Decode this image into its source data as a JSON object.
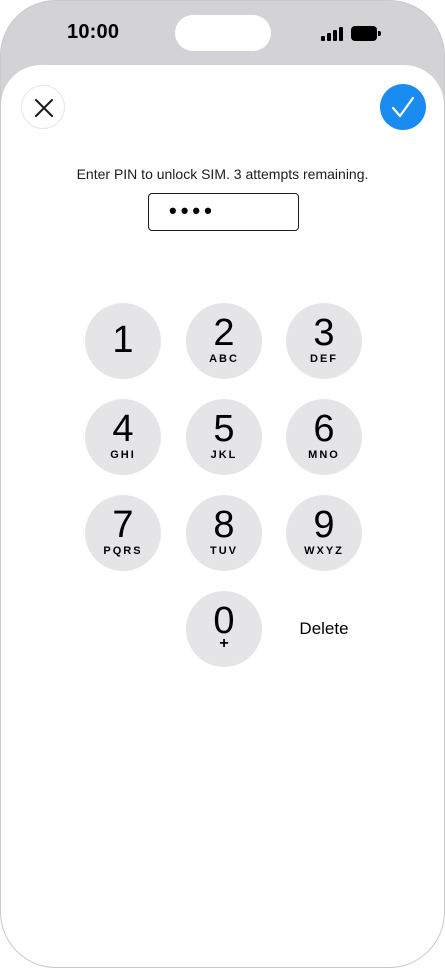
{
  "status_bar": {
    "time": "10:00",
    "signal_icon": "cellular-signal-icon",
    "battery_icon": "battery-full-icon"
  },
  "header": {
    "close_icon": "close-icon",
    "confirm_icon": "checkmark-icon",
    "accent_color": "#1a8cf1"
  },
  "pin": {
    "prompt": "Enter PIN to unlock SIM. 3 attempts remaining.",
    "masked_value": "••••"
  },
  "keypad": {
    "keys": [
      {
        "digit": "1",
        "letters": ""
      },
      {
        "digit": "2",
        "letters": "ABC"
      },
      {
        "digit": "3",
        "letters": "DEF"
      },
      {
        "digit": "4",
        "letters": "GHI"
      },
      {
        "digit": "5",
        "letters": "JKL"
      },
      {
        "digit": "6",
        "letters": "MNO"
      },
      {
        "digit": "7",
        "letters": "PQRS"
      },
      {
        "digit": "8",
        "letters": "TUV"
      },
      {
        "digit": "9",
        "letters": "WXYZ"
      },
      {
        "digit": "0",
        "letters": "+"
      }
    ],
    "delete_label": "Delete",
    "key_color": "#e5e5e7"
  }
}
